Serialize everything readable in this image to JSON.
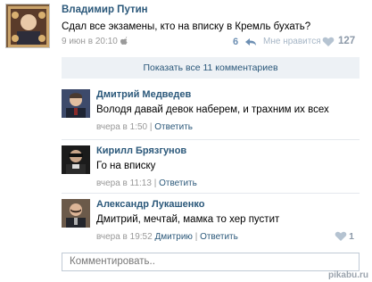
{
  "post": {
    "author": "Владимир Путин",
    "text": "Сдал все экзамены, кто на вписку в Кремль бухать?",
    "date": "9 июн в 20:10",
    "reply_count": "6",
    "like_label": "Мне нравится",
    "like_count": "127"
  },
  "show_all_label": "Показать все 11 комментариев",
  "comments": [
    {
      "author": "Дмитрий Медведев",
      "text": "Володя давай девок наберем, и трахним их всех",
      "time": "вчера в 1:50",
      "separator": "|",
      "reply_label": "Ответить"
    },
    {
      "author": "Кирилл Брязгунов",
      "text": "Го на вписку",
      "time": "вчера в 11:13",
      "separator": "|",
      "reply_label": "Ответить"
    },
    {
      "author": "Александр Лукашенко",
      "text": "Дмитрий, мечтай, мамка то хер пустит",
      "time": "вчера в 19:52",
      "reply_to": "Дмитрию",
      "separator": "|",
      "reply_label": "Ответить",
      "like_count": "1"
    }
  ],
  "comment_box": {
    "placeholder": "Комментировать.."
  },
  "watermark": "pikabu.ru",
  "icons": {
    "apple": "apple-icon",
    "reply": "reply-icon",
    "heart": "heart-icon"
  },
  "colors": {
    "link": "#2b587a",
    "muted": "#999999",
    "panel": "#edf1f5"
  }
}
